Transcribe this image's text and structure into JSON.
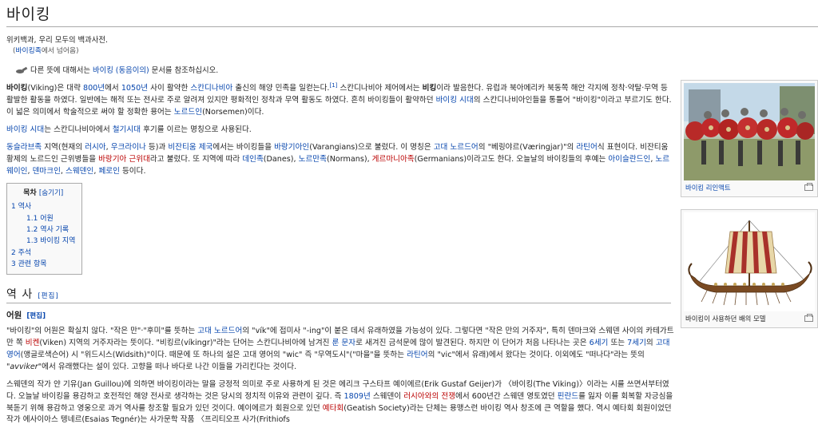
{
  "title": "바이킹",
  "tagline": "위키백과, 우리 모두의 백과사전.",
  "redirect": {
    "prefix": "(",
    "link": "바이킹족",
    "suffix": "에서 넘어옴)"
  },
  "hatnote": {
    "pre": "다른 뜻에 대해서는 ",
    "link": "바이킹 (동음이의)",
    "post": " 문서를 참조하십시오."
  },
  "p1": {
    "a_bold": "바이킹",
    "b": "(Viking)은 대략 ",
    "c_link": "800년",
    "d": "에서 ",
    "e_link": "1050년",
    "f": " 사이 활약한 ",
    "g_link": "스칸디나비아",
    "h": " 출신의 해양 민족을 일컫는다.",
    "i_ref": "[1]",
    "j": " 스칸디나비아 제어에서는 ",
    "k_bold": "비킹",
    "l": "이라 발음한다. 유럽과 북아메리카 북동쪽 해안 각지에 정착·약탈·무역 등 활발한 활동을 하였다. 일반에는 해적 또는 전사로 주로 알려져 있지만 평화적인 정착과 무역 활동도 하였다. 흔히 바이킹들이 활약하던 ",
    "m_link": "바이킹 시대",
    "n": "의 스칸디나비아인들을 통틀어 \"바이킹\"이라고 부르기도 한다. 이 넓은 의미에서 학술적으로 써야 할 정확한 용어는 ",
    "o_link": "노르드인",
    "p": "(Norsemen)이다."
  },
  "p2": {
    "a_link": "바이킹 시대",
    "b": "는 스칸디나비아에서 ",
    "c_link": "철기시대",
    "d": " 후기를 이르는 명칭으로 사용된다."
  },
  "p3": {
    "a_link": "동슬라브족",
    "b": " 지역(현재의 ",
    "c_link": "러시아",
    "d": ", ",
    "e_link": "우크라이나",
    "f": " 등)과 ",
    "g_link": "비잔티움 제국",
    "h": "에서는 바이킹들을 ",
    "i_link": "바랑기아인",
    "j": "(Varangians)으로 불렀다. 이 명칭은 ",
    "k_link": "고대 노르드어",
    "l": "의 \"베링야르(Væringjar)\"의 ",
    "m_link": "라틴어",
    "n": "식 표현이다. 비잔티움 황제의 노르드인 근위병들을 ",
    "o_red": "바랑기아 근위대",
    "p": "라고 불렀다. 또 지역에 따라 ",
    "q_link": "데인족",
    "r": "(Danes), ",
    "s_link": "노르만족",
    "t": "(Normans), ",
    "u_red": "게르마니아족",
    "v": "(Germanians)이라고도 한다. 오늘날의 바이킹들의 후예는 ",
    "w_link": "아이슬란드인",
    "x": ", ",
    "y_link": "노르웨이인",
    "z": ", ",
    "z1_link": "덴마크인",
    "z2": ", ",
    "z3_link": "스웨덴인",
    "z4": ", ",
    "z5_link": "페로인",
    "z6": " 등이다."
  },
  "toc": {
    "title": "목차",
    "toggle": "[숨기기]",
    "items": [
      {
        "num": "1",
        "label": "역사"
      },
      {
        "num": "1.1",
        "label": "어원"
      },
      {
        "num": "1.2",
        "label": "역사 기록"
      },
      {
        "num": "1.3",
        "label": "바이킹 지역"
      },
      {
        "num": "2",
        "label": "주석"
      },
      {
        "num": "3",
        "label": "관련 항목"
      }
    ]
  },
  "h2_history": {
    "label": "역 사",
    "edit": "[편집]"
  },
  "h3_origin": {
    "label": "어원",
    "edit": "[편집]"
  },
  "p4": {
    "a": "\"바이킹\"의 어원은 확실치 않다. \"작은 만\"·\"후미\"를 뜻하는 ",
    "b_link": "고대 노르드어",
    "c": "의 \"vík\"에 접미사 \"-ing\"이 붙은 데서 유래하였을 가능성이 있다. 그렇다면 \"작은 만의 거주자\", 특히 덴마크와 스웨덴 사이의 카테가트 만 쪽 ",
    "d_red": "비켄",
    "e": "(Viken) 지역의 거주자라는 뜻이다. \"비킹르(víkingr)\"라는 단어는 스칸디나비아에 남겨진 ",
    "f_link": "룬 문자",
    "g": "로 새겨진 금석문에 많이 발견된다. 하지만 이 단어가 처음 나타나는 곳은 ",
    "h_link": "6세기",
    "i": " 또는 ",
    "j_link": "7세기",
    "k": "의 ",
    "l_link": "고대 영어",
    "m": "(앵글로색슨어) 시 \"위드시스(Widsith)\"이다. 때문에 또 하나의 설은 고대 영어의 \"wic\" 즉 \"무역도시\"(\"마을\"을 뜻하는 ",
    "n_link": "라틴어",
    "o": "의 \"vic\"에서 유래)에서 왔다는 것이다. 이외에도 \"떠나다\"라는 뜻의 \"",
    "p_ital": "avviker",
    "q": "\"에서 유래했다는 설이 있다. 고향을 떠나 바다로 나간 이들을 가리킨다는 것이다."
  },
  "p5": {
    "a": "스웨덴의 작가 얀 기유(Jan Guillou)에 의하면 바이킹이라는 말을 긍정적 의미로 주로 사용하게 된 것은 에리크 구스타프 예이에르(Erik Gustaf Geijer)가 〈바이킹(The Viking)〉이라는 시를 쓰면서부터였다. 오늘날 바이킹을 용감하고 호전적인 해양 전사로 생각하는 것은 당시의 정치적 이유와 관련이 깊다. 즉 ",
    "b_link": "1809년",
    "c": " 스웨덴이 ",
    "d_red": "러시아와의 전쟁",
    "e": "에서 600년간 스웨덴 영토였던 ",
    "f_link": "핀란드",
    "g": "를 잃자 이를 회복할 자긍심을 북돋기 위해 용감하고 영웅으로 과거 역사를 창조할 필요가 있던 것이다. 예이에르가 회원으로 있던 ",
    "h_red": "예타회",
    "i": "(Geatish Society)라는 단체는 용맹스런 바이킹 역사 창조에 큰 역할을 했다. 역시 예타회 회원이었던 작가 에사이아스 텡네르(Esaias Tegnér)는 사가문학 작품 〈프리티오프 사가(Frithiofs"
  },
  "thumb1": {
    "caption_link": "바이킹 리인액트"
  },
  "thumb2": {
    "caption": "바이킹이 사용하던 배의 모델"
  },
  "colors": {
    "link": "#0645ad",
    "redlink": "#ba0000",
    "shield": "#c0282a",
    "sail_red": "#a8312a",
    "sail_cream": "#e8d7a8",
    "hull": "#7a4a22"
  }
}
